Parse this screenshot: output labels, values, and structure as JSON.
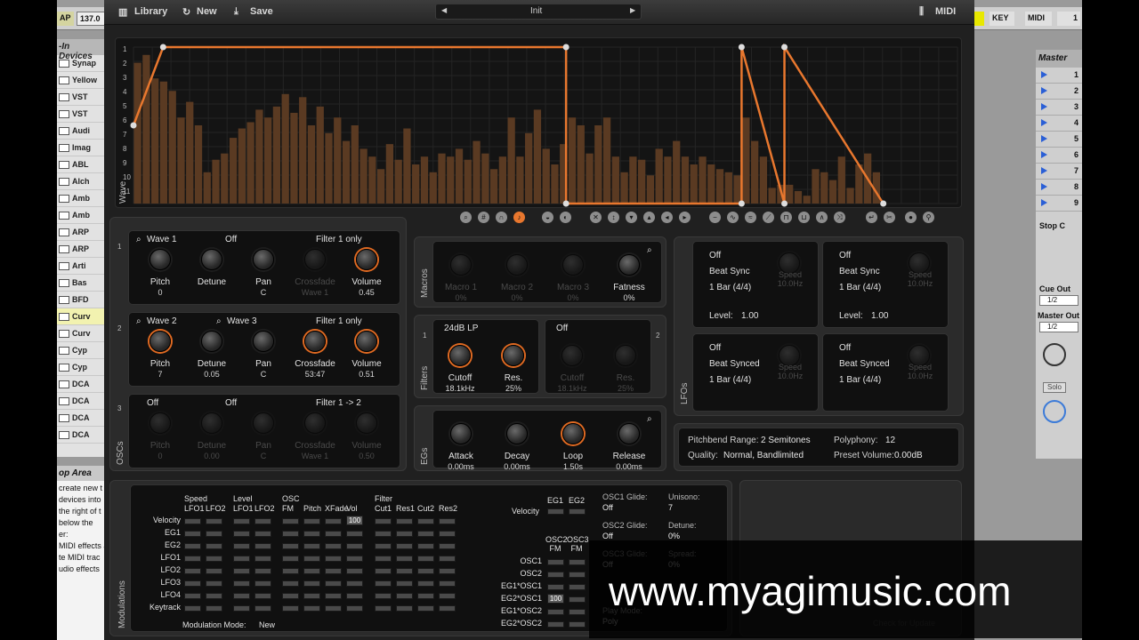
{
  "host": {
    "tempo_chip_a": "AP",
    "tempo": "137.0",
    "key_btn": "KEY",
    "midi_btn": "MIDI",
    "right_num": "1"
  },
  "browser": {
    "header": "-In Devices",
    "items": [
      "Synap",
      "Yellow",
      "VST",
      "VST",
      "Audi",
      "Imag",
      "ABL",
      "Alch",
      "Amb",
      "Amb",
      "ARP",
      "ARP",
      "Arti",
      "Bas",
      "BFD",
      "Curv",
      "Curv",
      "Cyp",
      "Cyp",
      "DCA",
      "DCA",
      "DCA",
      "DCA"
    ],
    "selected_index": 15
  },
  "help": {
    "title": "op Area",
    "lines": [
      "create new t",
      "devices into",
      "the right of t",
      "below the",
      "er:",
      "MIDI effects a",
      "te MIDI trac",
      "udio effects"
    ]
  },
  "mixer": {
    "title": "Master",
    "rows": [
      "1",
      "2",
      "3",
      "4",
      "5",
      "6",
      "7",
      "8",
      "9"
    ],
    "stop": "Stop C",
    "cue_out": "Cue Out",
    "cue_val": "1/2",
    "master_out": "Master Out",
    "master_val": "1/2",
    "solo": "Solo"
  },
  "toolbar": {
    "library": "Library",
    "new": "New",
    "save": "Save",
    "preset": "Init",
    "midi": "MIDI"
  },
  "wave": {
    "label": "Wave",
    "row_numbers": [
      "1",
      "2",
      "3",
      "4",
      "5",
      "6",
      "7",
      "8",
      "9",
      "10",
      "11"
    ],
    "bars": [
      0.9,
      0.95,
      0.8,
      0.78,
      0.72,
      0.55,
      0.65,
      0.5,
      0.2,
      0.28,
      0.32,
      0.42,
      0.48,
      0.52,
      0.6,
      0.55,
      0.62,
      0.7,
      0.58,
      0.68,
      0.5,
      0.62,
      0.45,
      0.55,
      0.4,
      0.5,
      0.35,
      0.3,
      0.22,
      0.38,
      0.28,
      0.48,
      0.25,
      0.3,
      0.2,
      0.32,
      0.3,
      0.35,
      0.28,
      0.4,
      0.32,
      0.22,
      0.3,
      0.55,
      0.3,
      0.45,
      0.6,
      0.35,
      0.25,
      0.38,
      0.55,
      0.5,
      0.32,
      0.5,
      0.55,
      0.3,
      0.2,
      0.3,
      0.28,
      0.18,
      0.35,
      0.3,
      0.4,
      0.3,
      0.25,
      0.3,
      0.25,
      0.22,
      0.2,
      0.18,
      0.55,
      0.4,
      0.3,
      0.1,
      0.12,
      0.12,
      0.08,
      0.05,
      0.22,
      0.2,
      0.15,
      0.3,
      0.1,
      0.25,
      0.32,
      0.2
    ],
    "envelope": [
      [
        0.0,
        0.5
      ],
      [
        0.036,
        0.0
      ],
      [
        0.525,
        0.0
      ],
      [
        0.525,
        1.0
      ],
      [
        0.738,
        1.0
      ],
      [
        0.738,
        0.0
      ],
      [
        0.79,
        1.0
      ],
      [
        0.79,
        0.0
      ],
      [
        0.91,
        1.0
      ]
    ]
  },
  "osc1": {
    "source": "Wave 1",
    "mode": "Off",
    "route": "Filter 1 only",
    "knobs": [
      {
        "label": "Pitch",
        "value": "0"
      },
      {
        "label": "Detune",
        "value": ""
      },
      {
        "label": "Pan",
        "value": "C"
      },
      {
        "label": "Crossfade",
        "value": "Wave 1"
      },
      {
        "label": "Volume",
        "value": "0.45"
      }
    ]
  },
  "osc2": {
    "source": "Wave 2",
    "source2": "Wave 3",
    "route": "Filter 1 only",
    "knobs": [
      {
        "label": "Pitch",
        "value": "7"
      },
      {
        "label": "Detune",
        "value": "0.05"
      },
      {
        "label": "Pan",
        "value": "C"
      },
      {
        "label": "Crossfade",
        "value": "53:47"
      },
      {
        "label": "Volume",
        "value": "0.51"
      }
    ]
  },
  "osc3": {
    "source": "Off",
    "mode": "Off",
    "route": "Filter 1 -> 2",
    "knobs": [
      {
        "label": "Pitch",
        "value": "0"
      },
      {
        "label": "Detune",
        "value": "0.00"
      },
      {
        "label": "Pan",
        "value": "C"
      },
      {
        "label": "Crossfade",
        "value": "Wave 1"
      },
      {
        "label": "Volume",
        "value": "0.50"
      }
    ]
  },
  "oscs_label": "OSCs",
  "macros": {
    "label": "Macros",
    "knobs": [
      {
        "label": "Macro 1",
        "value": "0%"
      },
      {
        "label": "Macro 2",
        "value": "0%"
      },
      {
        "label": "Macro 3",
        "value": "0%"
      },
      {
        "label": "Fatness",
        "value": "0%"
      }
    ]
  },
  "filters": {
    "label": "Filters",
    "f1_type": "24dB LP",
    "f2_type": "Off",
    "f1": [
      {
        "label": "Cutoff",
        "value": "18.1kHz"
      },
      {
        "label": "Res.",
        "value": "25%"
      }
    ],
    "f2": [
      {
        "label": "Cutoff",
        "value": "18.1kHz"
      },
      {
        "label": "Res.",
        "value": "25%"
      }
    ]
  },
  "egs": {
    "label": "EGs",
    "knobs": [
      {
        "label": "Attack",
        "value": "0.00ms"
      },
      {
        "label": "Decay",
        "value": "0.00ms"
      },
      {
        "label": "Loop",
        "value": "1.50s"
      },
      {
        "label": "Release",
        "value": "0.00ms"
      }
    ]
  },
  "lfos": {
    "label": "LFOs",
    "units": [
      {
        "mode": "Off",
        "sync": "Beat Sync",
        "rate": "1 Bar (4/4)",
        "speed": "Speed",
        "speed_val": "10.0Hz",
        "level": "Level:",
        "level_val": "1.00"
      },
      {
        "mode": "Off",
        "sync": "Beat Sync",
        "rate": "1 Bar (4/4)",
        "speed": "Speed",
        "speed_val": "10.0Hz",
        "level": "Level:",
        "level_val": "1.00"
      },
      {
        "mode": "Off",
        "sync": "Beat Synced",
        "rate": "1 Bar (4/4)",
        "speed": "Speed",
        "speed_val": "10.0Hz"
      },
      {
        "mode": "Off",
        "sync": "Beat Synced",
        "rate": "1 Bar (4/4)",
        "speed": "Speed",
        "speed_val": "10.0Hz"
      }
    ]
  },
  "global": {
    "pb_label": "Pitchbend Range:",
    "pb_val": "2 Semitones",
    "poly_label": "Polyphony:",
    "poly_val": "12",
    "quality_label": "Quality:",
    "quality_val": "Normal, Bandlimited",
    "pvol_label": "Preset Volume:",
    "pvol_val": "0.00dB"
  },
  "mods": {
    "label": "Modulations",
    "groups": [
      "Speed",
      "Level",
      "OSC",
      "Filter"
    ],
    "cols": [
      "LFO1",
      "LFO2",
      "LFO1",
      "LFO2",
      "FM",
      "Pitch",
      "XFade",
      "Vol",
      "Cut1",
      "Res1",
      "Cut2",
      "Res2"
    ],
    "rows": [
      "Velocity",
      "EG1",
      "EG2",
      "LFO1",
      "LFO2",
      "LFO3",
      "LFO4",
      "Keytrack"
    ],
    "vel_vol": "100",
    "mode_label": "Modulation Mode:",
    "mode_val": "New",
    "right_cols": [
      "EG1",
      "EG2"
    ],
    "velocity": "Velocity",
    "fm_cols": [
      "OSC2 FM",
      "OSC3 FM"
    ],
    "fm_rows": [
      "OSC1",
      "OSC2",
      "EG1*OSC1",
      "EG2*OSC1",
      "EG1*OSC2",
      "EG2*OSC2"
    ],
    "fm_val": "100"
  },
  "glide": {
    "osc1_label": "OSC1 Glide:",
    "osc1_val": "Off",
    "osc2_label": "OSC2 Glide:",
    "osc2_val": "Off",
    "osc3_label": "OSC3 Glide:",
    "osc3_val": "Off",
    "unison_label": "Unisono:",
    "unison_val": "7",
    "detune_label": "Detune:",
    "detune_val": "0%",
    "spread_label": "Spread:",
    "spread_val": "0%",
    "playmode_label": "Play Mode:",
    "playmode_val": "Poly",
    "update": "Check for Update"
  },
  "watermark": "www.myagimusic.com",
  "colors": {
    "accent": "#e8772e",
    "panel": "#2b2b2b",
    "bg": "#202020"
  }
}
